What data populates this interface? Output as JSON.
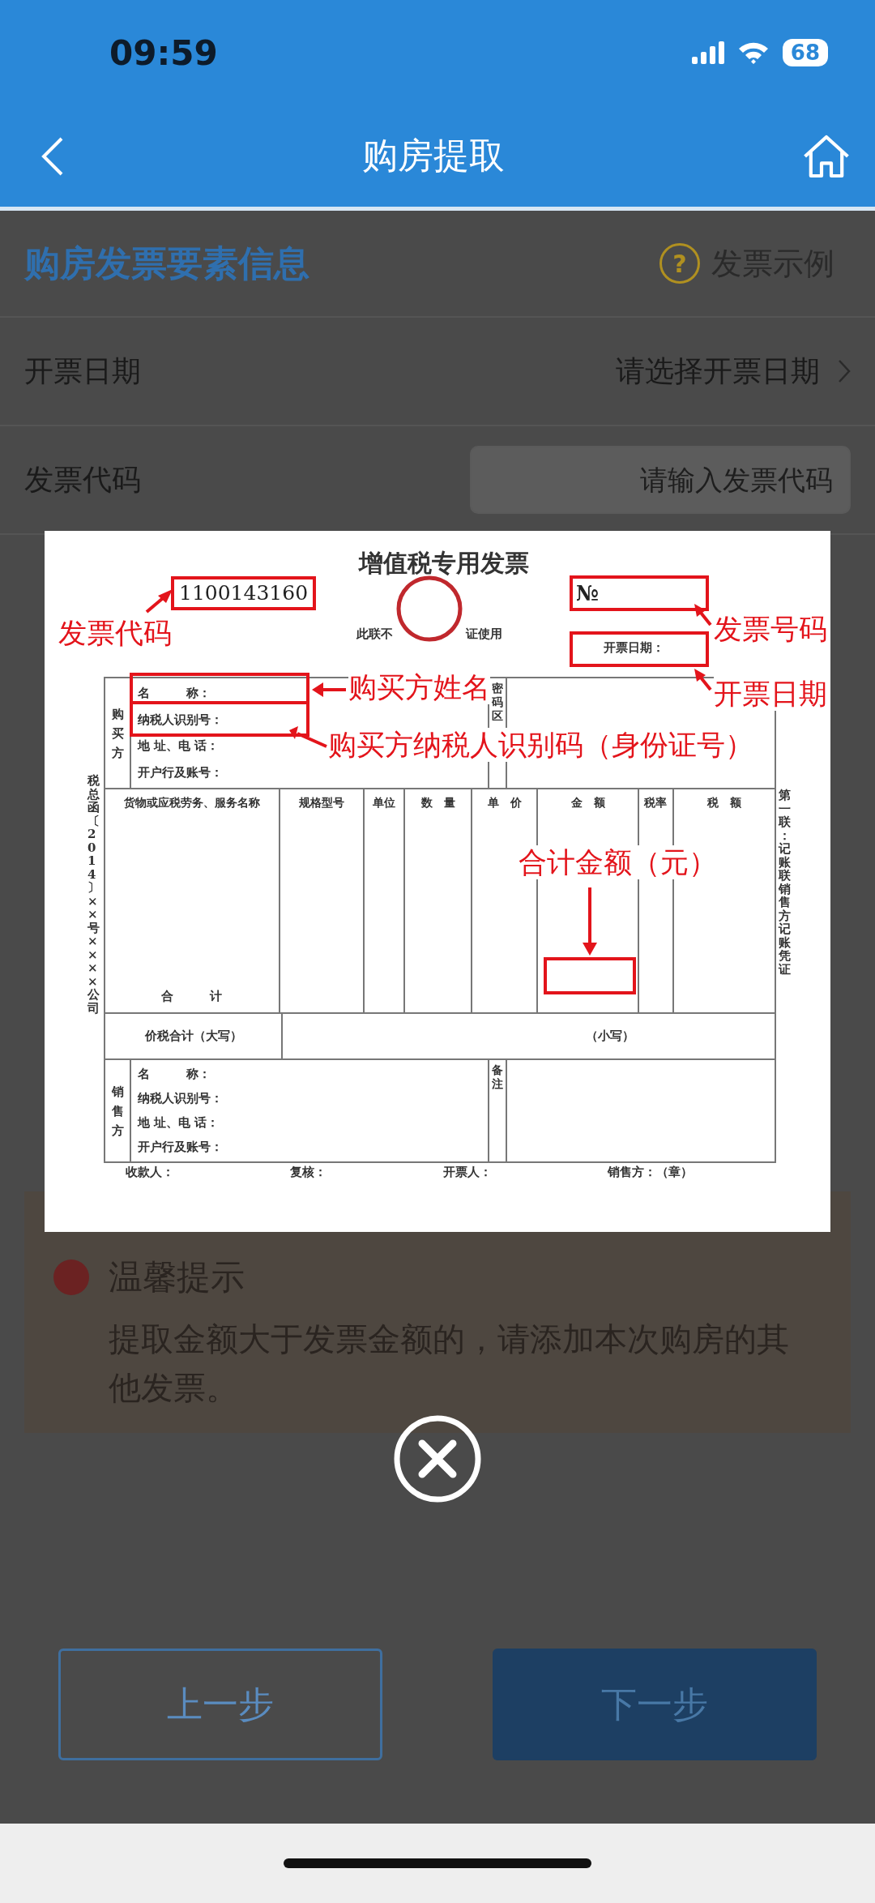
{
  "status_bar": {
    "time": "09:59",
    "battery": "68"
  },
  "nav": {
    "title": "购房提取"
  },
  "section": {
    "title": "购房发票要素信息",
    "example_link": "发票示例",
    "help_icon": "?"
  },
  "rows": [
    {
      "kind": "select",
      "label": "开票日期",
      "value": "请选择开票日期"
    },
    {
      "kind": "input",
      "label": "发票代码",
      "placeholder": "请输入发票代码"
    }
  ],
  "tip": {
    "title": "温馨提示",
    "text": "提取金额大于发票金额的，请添加本次购房的其他发票。"
  },
  "buttons": [
    {
      "kind": "secondary",
      "label": "上一步"
    },
    {
      "kind": "primary",
      "label": "下一步"
    }
  ],
  "invoice": {
    "title": "增值税专用发票",
    "code": "1100143160",
    "number_mark": "№",
    "date_label": "开票日期：",
    "notice_parts": [
      "此联不",
      "证使用"
    ],
    "buyer": {
      "label": "购买方",
      "fields": [
        "名　　　称：",
        "纳税人识别号：",
        "地 址、电 话：",
        "开户行及账号："
      ]
    },
    "password_area": "密码区",
    "columns": [
      "货物或应税劳务、服务名称",
      "规格型号",
      "单位",
      "数　量",
      "单　价",
      "金　额",
      "税率",
      "税　额"
    ],
    "subtotal": "合　　　计",
    "total_label": "价税合计（大写）",
    "total_small": "（小写）",
    "seller": {
      "label": "销售方",
      "fields": [
        "名　　　称：",
        "纳税人识别号：",
        "地 址、电 话：",
        "开户行及账号："
      ]
    },
    "remarks": "备注",
    "footer": [
      "收款人：",
      "复核：",
      "开票人：",
      "销售方：（章）"
    ],
    "side_note": "税总函〔2014〕××号××××公司",
    "copy_note": "第一联：记账联销售方记账凭证",
    "annotations": [
      {
        "kind": "code",
        "text": "发票代码"
      },
      {
        "kind": "number",
        "text": "发票号码"
      },
      {
        "kind": "date",
        "text": "开票日期"
      },
      {
        "kind": "name",
        "text": "购买方姓名"
      },
      {
        "kind": "taxid",
        "text": "购买方纳税人识别码（身份证号）"
      },
      {
        "kind": "amount",
        "text": "合计金额（元）"
      }
    ]
  }
}
